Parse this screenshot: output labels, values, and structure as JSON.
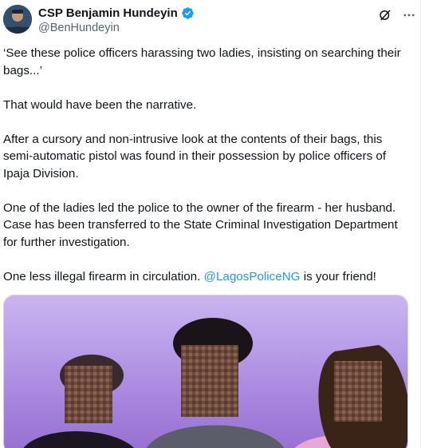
{
  "author": {
    "display_name": "CSP Benjamin Hundeyin",
    "handle": "@BenHundeyin",
    "verified_icon": "verified-badge-icon",
    "accent": "#1d9bf0"
  },
  "actions": {
    "grok_icon": "grok-icon",
    "more_icon": "more-icon"
  },
  "tweet": {
    "paragraphs": [
      "‘See these police officers harassing two ladies, insisting on searching their bags...’",
      "That would have been the narrative.",
      "After a cursory and non-intrusive look at the contents of their bags, this semi-automatic pistol was found in their possession by police officers of Ipaja Division.",
      "One of the ladies led the police to the owner of the firearm - her husband. Case has been transferred to the State Criminal Investigation Department for further investigation."
    ],
    "last_para_before": "One less illegal firearm in circulation. ",
    "mention": "@LagosPoliceNG",
    "last_para_after": " is your friend!"
  },
  "colors": {
    "text": "#0f1419",
    "secondary": "#536471",
    "link": "#1d9bf0",
    "media_bg": "#b89ce8"
  }
}
